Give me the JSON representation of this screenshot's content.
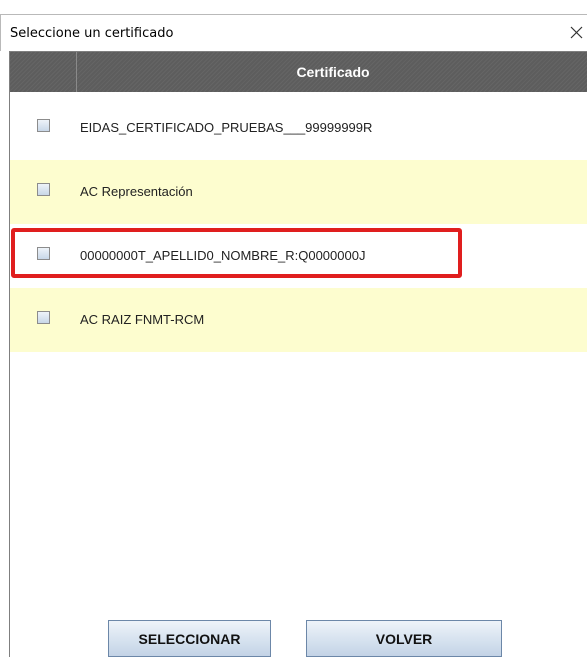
{
  "dialog": {
    "title": "Seleccione un certificado",
    "close_glyph": "✕"
  },
  "table": {
    "column_header": "Certificado",
    "rows": [
      {
        "label": "EIDAS_CERTIFICADO_PRUEBAS___99999999R",
        "checked": false
      },
      {
        "label": "AC Representación",
        "checked": false
      },
      {
        "label": "00000000T_APELLID0_NOMBRE_R:Q0000000J",
        "checked": false,
        "highlighted": true
      },
      {
        "label": "AC RAIZ FNMT-RCM",
        "checked": false
      }
    ]
  },
  "buttons": {
    "select_label": "SELECCIONAR",
    "back_label": "VOLVER"
  },
  "colors": {
    "header_bg": "#5d5d5d",
    "row_alt_bg": "#fdfdcf",
    "highlight": "#e01e1e"
  },
  "icons": {
    "close": "close-icon",
    "checkbox": "checkbox-icon"
  }
}
